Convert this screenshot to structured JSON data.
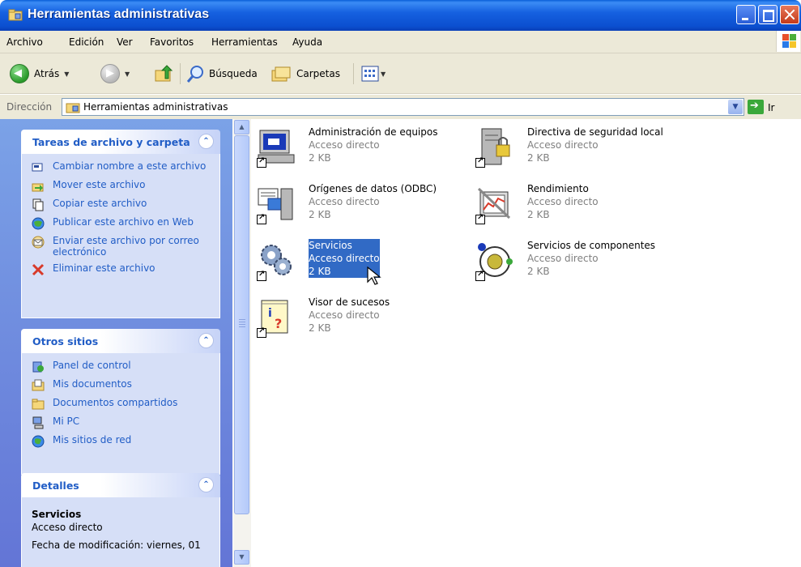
{
  "window": {
    "title": "Herramientas administrativas"
  },
  "menu": [
    "Archivo",
    "Edición",
    "Ver",
    "Favoritos",
    "Herramientas",
    "Ayuda"
  ],
  "toolbar": {
    "back": "Atrás",
    "search": "Búsqueda",
    "folders": "Carpetas"
  },
  "address": {
    "label": "Dirección",
    "value": "Herramientas administrativas",
    "go": "Ir"
  },
  "tasks_panel": {
    "title": "Tareas de archivo y carpeta",
    "items": [
      "Cambiar nombre a este archivo",
      "Mover este archivo",
      "Copiar este archivo",
      "Publicar este archivo en Web",
      "Enviar este archivo por correo electrónico",
      "Eliminar este archivo"
    ]
  },
  "places_panel": {
    "title": "Otros sitios",
    "items": [
      "Panel de control",
      "Mis documentos",
      "Documentos compartidos",
      "Mi PC",
      "Mis sitios de red"
    ]
  },
  "details_panel": {
    "title": "Detalles",
    "name": "Servicios",
    "type": "Acceso directo",
    "modified": "Fecha de modificación: viernes, 01"
  },
  "files": [
    {
      "name": "Administración de equipos",
      "type": "Acceso directo",
      "size": "2 KB"
    },
    {
      "name": "Directiva de seguridad local",
      "type": "Acceso directo",
      "size": "2 KB"
    },
    {
      "name": "Orígenes de datos (ODBC)",
      "type": "Acceso directo",
      "size": "2 KB"
    },
    {
      "name": "Rendimiento",
      "type": "Acceso directo",
      "size": "2 KB"
    },
    {
      "name": "Servicios",
      "type": "Acceso directo",
      "size": "2 KB",
      "selected": true
    },
    {
      "name": "Servicios de componentes",
      "type": "Acceso directo",
      "size": "2 KB"
    },
    {
      "name": "Visor de sucesos",
      "type": "Acceso directo",
      "size": "2 KB"
    }
  ],
  "colors": {
    "title_bar": "#0b4fd0",
    "task_link": "#215dc6",
    "selection": "#316ac5",
    "left_pane": "#7ba2e7"
  }
}
